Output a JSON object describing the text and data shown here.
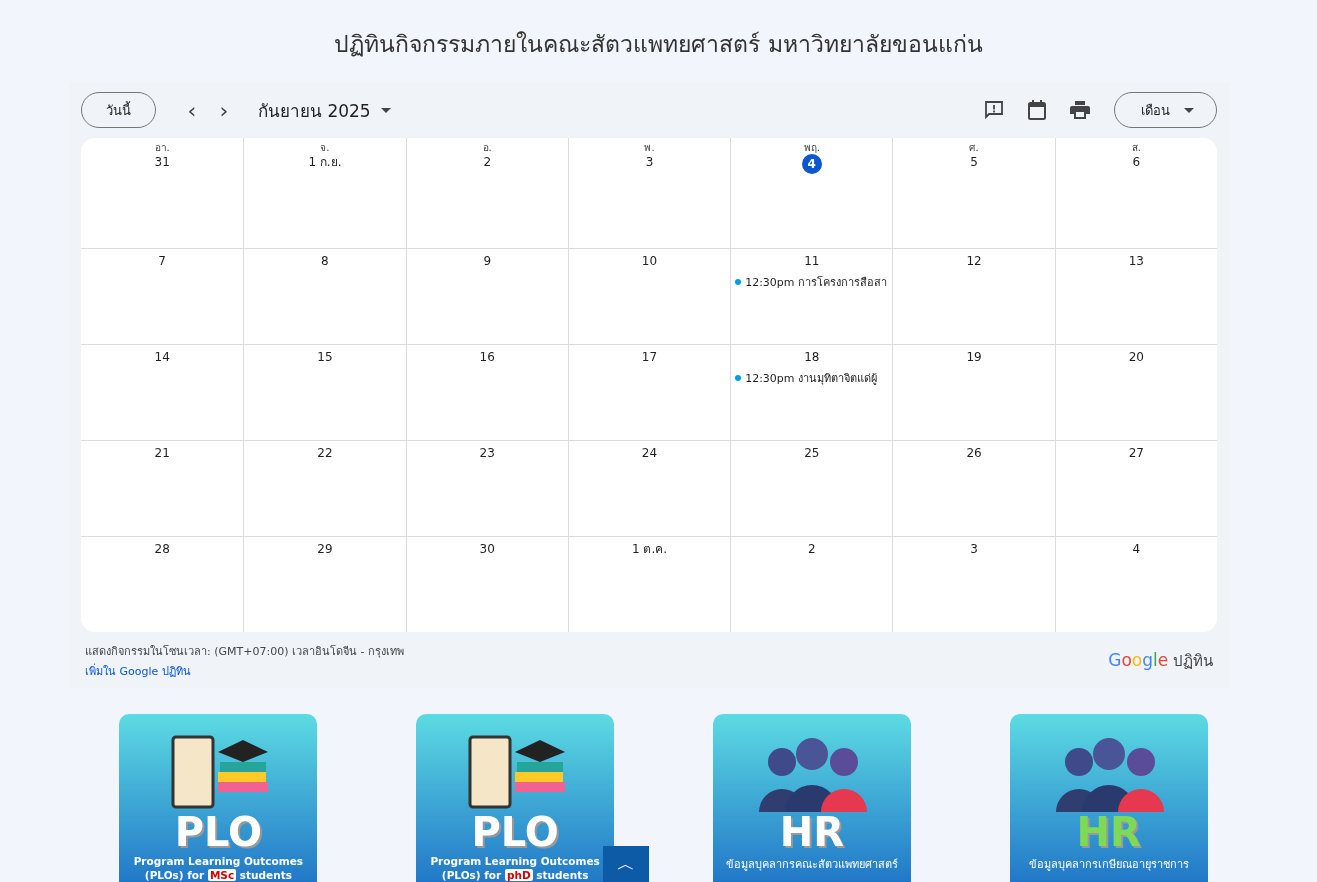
{
  "page_title": "ปฏิทินกิจกรรมภายในคณะสัตวแพทยศาสตร์ มหาวิทยาลัยขอนแก่น",
  "toolbar": {
    "today_button": "วันนี้",
    "prev": "‹",
    "next": "›",
    "month_label": "กันยายน 2025",
    "view_button": "เดือน"
  },
  "weekdays": [
    "อา.",
    "จ.",
    "อ.",
    "พ.",
    "พฤ.",
    "ศ.",
    "ส."
  ],
  "weeks": [
    [
      {
        "day": "31",
        "today": false
      },
      {
        "day": "1 ก.ย.",
        "today": false
      },
      {
        "day": "2",
        "today": false
      },
      {
        "day": "3",
        "today": false
      },
      {
        "day": "4",
        "today": true
      },
      {
        "day": "5",
        "today": false
      },
      {
        "day": "6",
        "today": false
      }
    ],
    [
      {
        "day": "7",
        "today": false
      },
      {
        "day": "8",
        "today": false
      },
      {
        "day": "9",
        "today": false
      },
      {
        "day": "10",
        "today": false
      },
      {
        "day": "11",
        "today": false,
        "events": [
          {
            "time": "12:30pm",
            "title": "การโครงการสือสา",
            "color": "#039be5"
          }
        ]
      },
      {
        "day": "12",
        "today": false
      },
      {
        "day": "13",
        "today": false
      }
    ],
    [
      {
        "day": "14",
        "today": false
      },
      {
        "day": "15",
        "today": false
      },
      {
        "day": "16",
        "today": false
      },
      {
        "day": "17",
        "today": false
      },
      {
        "day": "18",
        "today": false,
        "events": [
          {
            "time": "12:30pm",
            "title": "งานมุทิตาจิตแด่ผู้",
            "color": "#039be5"
          }
        ]
      },
      {
        "day": "19",
        "today": false
      },
      {
        "day": "20",
        "today": false
      }
    ],
    [
      {
        "day": "21",
        "today": false
      },
      {
        "day": "22",
        "today": false
      },
      {
        "day": "23",
        "today": false
      },
      {
        "day": "24",
        "today": false
      },
      {
        "day": "25",
        "today": false
      },
      {
        "day": "26",
        "today": false
      },
      {
        "day": "27",
        "today": false
      }
    ],
    [
      {
        "day": "28",
        "today": false
      },
      {
        "day": "29",
        "today": false
      },
      {
        "day": "30",
        "today": false
      },
      {
        "day": "1 ต.ค.",
        "today": false
      },
      {
        "day": "2",
        "today": false
      },
      {
        "day": "3",
        "today": false
      },
      {
        "day": "4",
        "today": false
      }
    ]
  ],
  "footer": {
    "timezone": "แสดงกิจกรรมในโซนเวลา: (GMT+07:00) เวลาอินโดจีน - กรุงเทพ",
    "add_link": "เพิ่มใน Google ปฏิทิน",
    "brand": "Google",
    "brand_suffix": "ปฏิทิน"
  },
  "cards": [
    {
      "kind": "plo",
      "label": "PLO",
      "color": "#ffffff",
      "caption": [
        {
          "text": "Program Learning Outcomes (PLOs) for ",
          "highlight": false
        },
        {
          "text": "MSc",
          "highlight": true
        },
        {
          "text": " students",
          "highlight": false
        }
      ]
    },
    {
      "kind": "plo",
      "label": "PLO",
      "color": "#ffffff",
      "caption": [
        {
          "text": "Program Learning Outcomes (PLOs) for ",
          "highlight": false
        },
        {
          "text": "phD",
          "highlight": true
        },
        {
          "text": " students",
          "highlight": false
        }
      ]
    },
    {
      "kind": "hr",
      "label": "HR",
      "color": "#ffffff",
      "caption": [
        {
          "text": "ข้อมูลบุคลากรคณะสัตวแพทยศาสตร์",
          "highlight": false
        }
      ]
    },
    {
      "kind": "hr",
      "label": "HR",
      "color": "#7ed957",
      "caption": [
        {
          "text": "ข้อมูลบุคลากรเกษียณอายุราชการ",
          "highlight": false
        }
      ]
    }
  ],
  "scroll_top": "︿"
}
